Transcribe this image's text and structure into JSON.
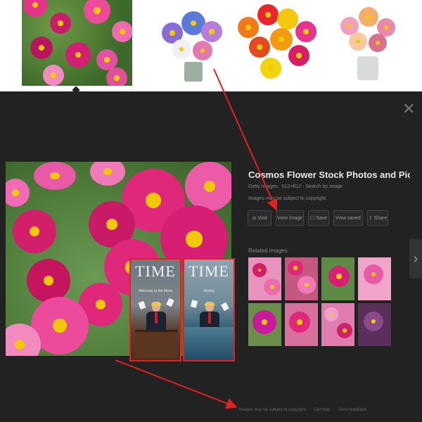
{
  "preview": {
    "title": "Cosmos Flower Stock Photos and Pic...",
    "meta": "Getty Images · 612×612 · Search by image",
    "link": "Images may be subject to copyright",
    "close_icon": "close-icon",
    "actions": [
      {
        "label": "◎ Visit"
      },
      {
        "label": "View image"
      },
      {
        "label": "☐ Save"
      },
      {
        "label": "View saved"
      },
      {
        "label": "⇪ Share"
      }
    ],
    "related_label": "Related images",
    "next_icon": "chevron-right-icon"
  },
  "footer": {
    "links": [
      "Images may be subject to copyright",
      "Get help",
      "Send feedback"
    ]
  },
  "covers": [
    {
      "wordmark": "TIME",
      "subtitle": "Welcome to the Mess"
    },
    {
      "wordmark": "TIME",
      "subtitle": "Stormy"
    }
  ],
  "colors": {
    "annotation_red": "#e12020",
    "panel_bg": "#222222",
    "accent_pink": "#e0287a",
    "flower_center": "#f2c90a"
  }
}
